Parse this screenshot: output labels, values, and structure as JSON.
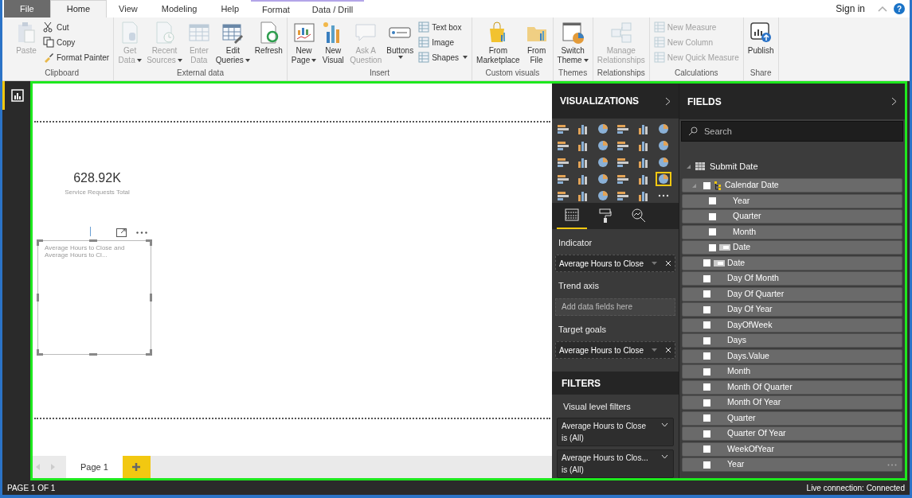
{
  "ribbon": {
    "tabs": [
      {
        "label": "File",
        "kind": "file",
        "selected": false
      },
      {
        "label": "Home",
        "kind": "normal",
        "selected": true
      },
      {
        "label": "View",
        "kind": "normal",
        "selected": false
      },
      {
        "label": "Modeling",
        "kind": "normal",
        "selected": false
      },
      {
        "label": "Help",
        "kind": "normal",
        "selected": false
      },
      {
        "label": "Format",
        "kind": "contextual",
        "selected": false
      },
      {
        "label": "Data / Drill",
        "kind": "contextual",
        "selected": false
      }
    ],
    "sign_in": "Sign in",
    "help": "?",
    "groups": [
      {
        "label": "Clipboard",
        "items": [
          {
            "kind": "large",
            "lines": [
              "Paste"
            ],
            "disabled": true,
            "dropdown": false
          },
          {
            "kind": "stack",
            "items": [
              {
                "label": "Cut",
                "disabled": false
              },
              {
                "label": "Copy",
                "disabled": false
              },
              {
                "label": "Format Painter",
                "disabled": false
              }
            ]
          }
        ]
      },
      {
        "label": "External data",
        "items": [
          {
            "kind": "large",
            "lines": [
              "Get",
              "Data"
            ],
            "disabled": true,
            "dropdown": true
          },
          {
            "kind": "large",
            "lines": [
              "Recent",
              "Sources"
            ],
            "disabled": true,
            "dropdown": true
          },
          {
            "kind": "large",
            "lines": [
              "Enter",
              "Data"
            ],
            "disabled": true,
            "dropdown": false
          },
          {
            "kind": "large",
            "lines": [
              "Edit",
              "Queries"
            ],
            "disabled": false,
            "dropdown": true
          },
          {
            "kind": "large",
            "lines": [
              "Refresh"
            ],
            "disabled": false,
            "dropdown": false
          }
        ]
      },
      {
        "label": "Insert",
        "items": [
          {
            "kind": "large",
            "lines": [
              "New",
              "Page"
            ],
            "disabled": false,
            "dropdown": true
          },
          {
            "kind": "large",
            "lines": [
              "New",
              "Visual"
            ],
            "disabled": false,
            "dropdown": false
          },
          {
            "kind": "large",
            "lines": [
              "Ask A",
              "Question"
            ],
            "disabled": true,
            "dropdown": false
          },
          {
            "kind": "large",
            "lines": [
              "Buttons"
            ],
            "disabled": false,
            "dropdown": true
          },
          {
            "kind": "stack",
            "items": [
              {
                "label": "Text box",
                "disabled": false
              },
              {
                "label": "Image",
                "disabled": false
              },
              {
                "label": "Shapes",
                "disabled": false,
                "dropdown": true
              }
            ]
          }
        ]
      },
      {
        "label": "Custom visuals",
        "items": [
          {
            "kind": "large",
            "lines": [
              "From",
              "Marketplace"
            ],
            "disabled": false,
            "dropdown": false
          },
          {
            "kind": "large",
            "lines": [
              "From",
              "File"
            ],
            "disabled": false,
            "dropdown": false
          }
        ]
      },
      {
        "label": "Themes",
        "items": [
          {
            "kind": "large",
            "lines": [
              "Switch",
              "Theme"
            ],
            "disabled": false,
            "dropdown": true
          }
        ]
      },
      {
        "label": "Relationships",
        "items": [
          {
            "kind": "large",
            "lines": [
              "Manage",
              "Relationships"
            ],
            "disabled": true,
            "dropdown": false
          }
        ]
      },
      {
        "label": "Calculations",
        "items": [
          {
            "kind": "stack",
            "items": [
              {
                "label": "New Measure",
                "disabled": true
              },
              {
                "label": "New Column",
                "disabled": true
              },
              {
                "label": "New Quick Measure",
                "disabled": true
              }
            ]
          }
        ]
      },
      {
        "label": "Share",
        "items": [
          {
            "kind": "large",
            "lines": [
              "Publish"
            ],
            "disabled": false,
            "dropdown": false
          }
        ]
      }
    ]
  },
  "canvas": {
    "card": {
      "value": "628.92K",
      "label": "Service Requests Total"
    },
    "selected_visual": {
      "title": "Average Hours to Close and Average Hours to Cl..."
    },
    "pages": [
      {
        "label": "Page 1",
        "selected": true
      }
    ]
  },
  "visualizations": {
    "title": "VISUALIZATIONS",
    "icons": [
      {
        "selected": false
      },
      {
        "selected": false
      },
      {
        "selected": false
      },
      {
        "selected": false
      },
      {
        "selected": false
      },
      {
        "selected": false
      },
      {
        "selected": false
      },
      {
        "selected": false
      },
      {
        "selected": false
      },
      {
        "selected": false
      },
      {
        "selected": false
      },
      {
        "selected": false
      },
      {
        "selected": false
      },
      {
        "selected": false
      },
      {
        "selected": false
      },
      {
        "selected": false
      },
      {
        "selected": false
      },
      {
        "selected": false
      },
      {
        "selected": false
      },
      {
        "selected": false
      },
      {
        "selected": false
      },
      {
        "selected": false
      },
      {
        "selected": false
      },
      {
        "selected": true
      },
      {
        "selected": false
      },
      {
        "selected": false
      },
      {
        "selected": false
      },
      {
        "selected": false
      },
      {
        "selected": false
      }
    ],
    "pane_tabs": [
      {
        "selected": true
      },
      {
        "selected": false
      },
      {
        "selected": false
      }
    ],
    "wells": [
      {
        "label": "Indicator",
        "field": "Average Hours to Close"
      },
      {
        "label": "Trend axis",
        "placeholder": "Add data fields here"
      },
      {
        "label": "Target goals",
        "field": "Average Hours to Close"
      }
    ]
  },
  "filters": {
    "title": "FILTERS",
    "section": "Visual level filters",
    "cards": [
      {
        "title": "Average Hours to Close",
        "value": "is (All)"
      },
      {
        "title": "Average Hours to Clos...",
        "value": "is (All)"
      }
    ]
  },
  "fields": {
    "title": "FIELDS",
    "search": {
      "placeholder": "Search"
    },
    "tables": [
      {
        "name": "Submit Date",
        "expanded": true,
        "children": [
          {
            "name": "Calendar Date",
            "kind": "hierarchy",
            "expanded": true,
            "checked": false,
            "children": [
              {
                "name": "Year",
                "kind": "level",
                "checked": false
              },
              {
                "name": "Quarter",
                "kind": "level",
                "checked": false
              },
              {
                "name": "Month",
                "kind": "level",
                "checked": false
              },
              {
                "name": "Date",
                "kind": "date",
                "checked": false
              }
            ]
          },
          {
            "name": "Date",
            "kind": "date",
            "checked": false
          },
          {
            "name": "Day Of Month",
            "kind": "field",
            "checked": false
          },
          {
            "name": "Day Of Quarter",
            "kind": "field",
            "checked": false
          },
          {
            "name": "Day Of Year",
            "kind": "field",
            "checked": false
          },
          {
            "name": "DayOfWeek",
            "kind": "field",
            "checked": false
          },
          {
            "name": "Days",
            "kind": "field",
            "checked": false
          },
          {
            "name": "Days.Value",
            "kind": "field",
            "checked": false
          },
          {
            "name": "Month",
            "kind": "field",
            "checked": false
          },
          {
            "name": "Month Of Quarter",
            "kind": "field",
            "checked": false
          },
          {
            "name": "Month Of Year",
            "kind": "field",
            "checked": false
          },
          {
            "name": "Quarter",
            "kind": "field",
            "checked": false
          },
          {
            "name": "Quarter Of Year",
            "kind": "field",
            "checked": false
          },
          {
            "name": "WeekOfYear",
            "kind": "field",
            "checked": false
          },
          {
            "name": "Year",
            "kind": "field",
            "checked": false,
            "hovered": true
          }
        ]
      }
    ]
  },
  "status_bar": {
    "page": "PAGE 1 OF 1",
    "connection": "Live connection: Connected"
  }
}
